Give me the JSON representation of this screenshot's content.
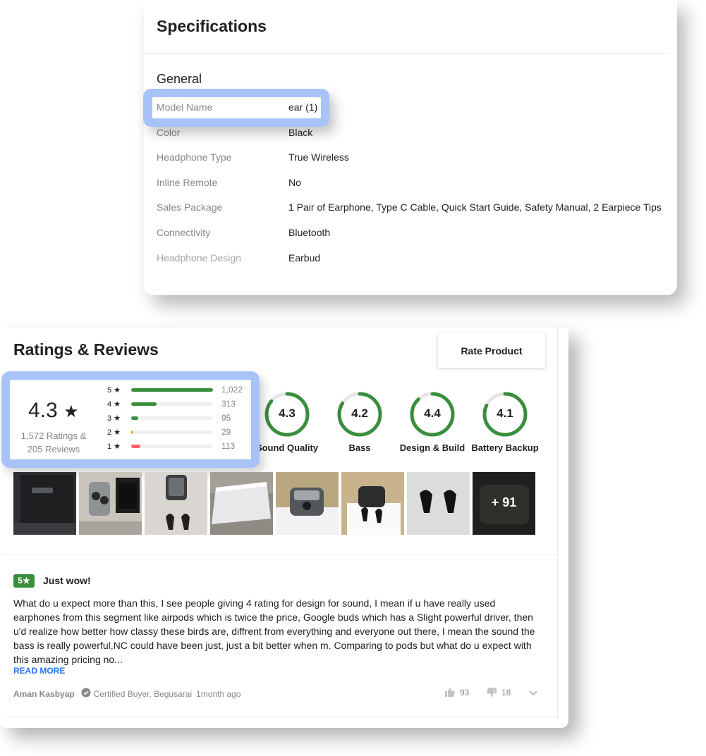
{
  "specifications": {
    "title": "Specifications",
    "section": "General",
    "rows": [
      {
        "key": "Model Name",
        "value": "ear (1)"
      },
      {
        "key": "Color",
        "value": "Black"
      },
      {
        "key": "Headphone Type",
        "value": "True Wireless"
      },
      {
        "key": "Inline Remote",
        "value": "No"
      },
      {
        "key": "Sales Package",
        "value": "1 Pair of Earphone, Type C Cable, Quick Start Guide, Safety Manual, 2 Earpiece Tips"
      },
      {
        "key": "Connectivity",
        "value": "Bluetooth"
      },
      {
        "key": "Headphone Design",
        "value": "Earbud"
      }
    ]
  },
  "ratings": {
    "title": "Ratings & Reviews",
    "rate_button": "Rate Product",
    "average": "4.3",
    "star": "★",
    "ratings_count": "1,572 Ratings &",
    "reviews_count": "205 Reviews",
    "breakdown": [
      {
        "label": "5 ★",
        "count": "1,022",
        "fraction": 1.0,
        "color": "#388e3c"
      },
      {
        "label": "4 ★",
        "count": "313",
        "fraction": 0.31,
        "color": "#388e3c"
      },
      {
        "label": "3 ★",
        "count": "95",
        "fraction": 0.09,
        "color": "#388e3c"
      },
      {
        "label": "2 ★",
        "count": "29",
        "fraction": 0.03,
        "color": "#ff9f00"
      },
      {
        "label": "1 ★",
        "count": "113",
        "fraction": 0.11,
        "color": "#ff6161"
      }
    ],
    "features": [
      {
        "value": "4.3",
        "label": "Sound Quality",
        "score": 4.3
      },
      {
        "value": "4.2",
        "label": "Bass",
        "score": 4.2
      },
      {
        "value": "4.4",
        "label": "Design & Build",
        "score": 4.4
      },
      {
        "value": "4.1",
        "label": "Battery Backup",
        "score": 4.1
      }
    ],
    "photos_more": "+ 91"
  },
  "review": {
    "rating": "5",
    "star": "★",
    "title": "Just wow!",
    "body": "What do u expect more than this, I see people giving 4 rating for design for sound, I mean if u have really used earphones from this segment like airpods which is twice the price, Google buds which has a Slight powerful driver, then u'd realize how better how classy these birds are, diffrent from everything and everyone out there, I mean the sound the bass is really powerful,NC could have been just, just a bit better when m. Comparing to pods but what do u expect with this amazing pricing no...",
    "read_more": "READ MORE",
    "author": "Aman Kasbyap",
    "certified": "Certified Buyer, Begusarai",
    "time": "1month ago",
    "likes": "93",
    "dislikes": "18"
  },
  "colors": {
    "accent_blue": "#2874f0",
    "rating_green": "#388e3c",
    "highlight": "#a7c3f7"
  }
}
